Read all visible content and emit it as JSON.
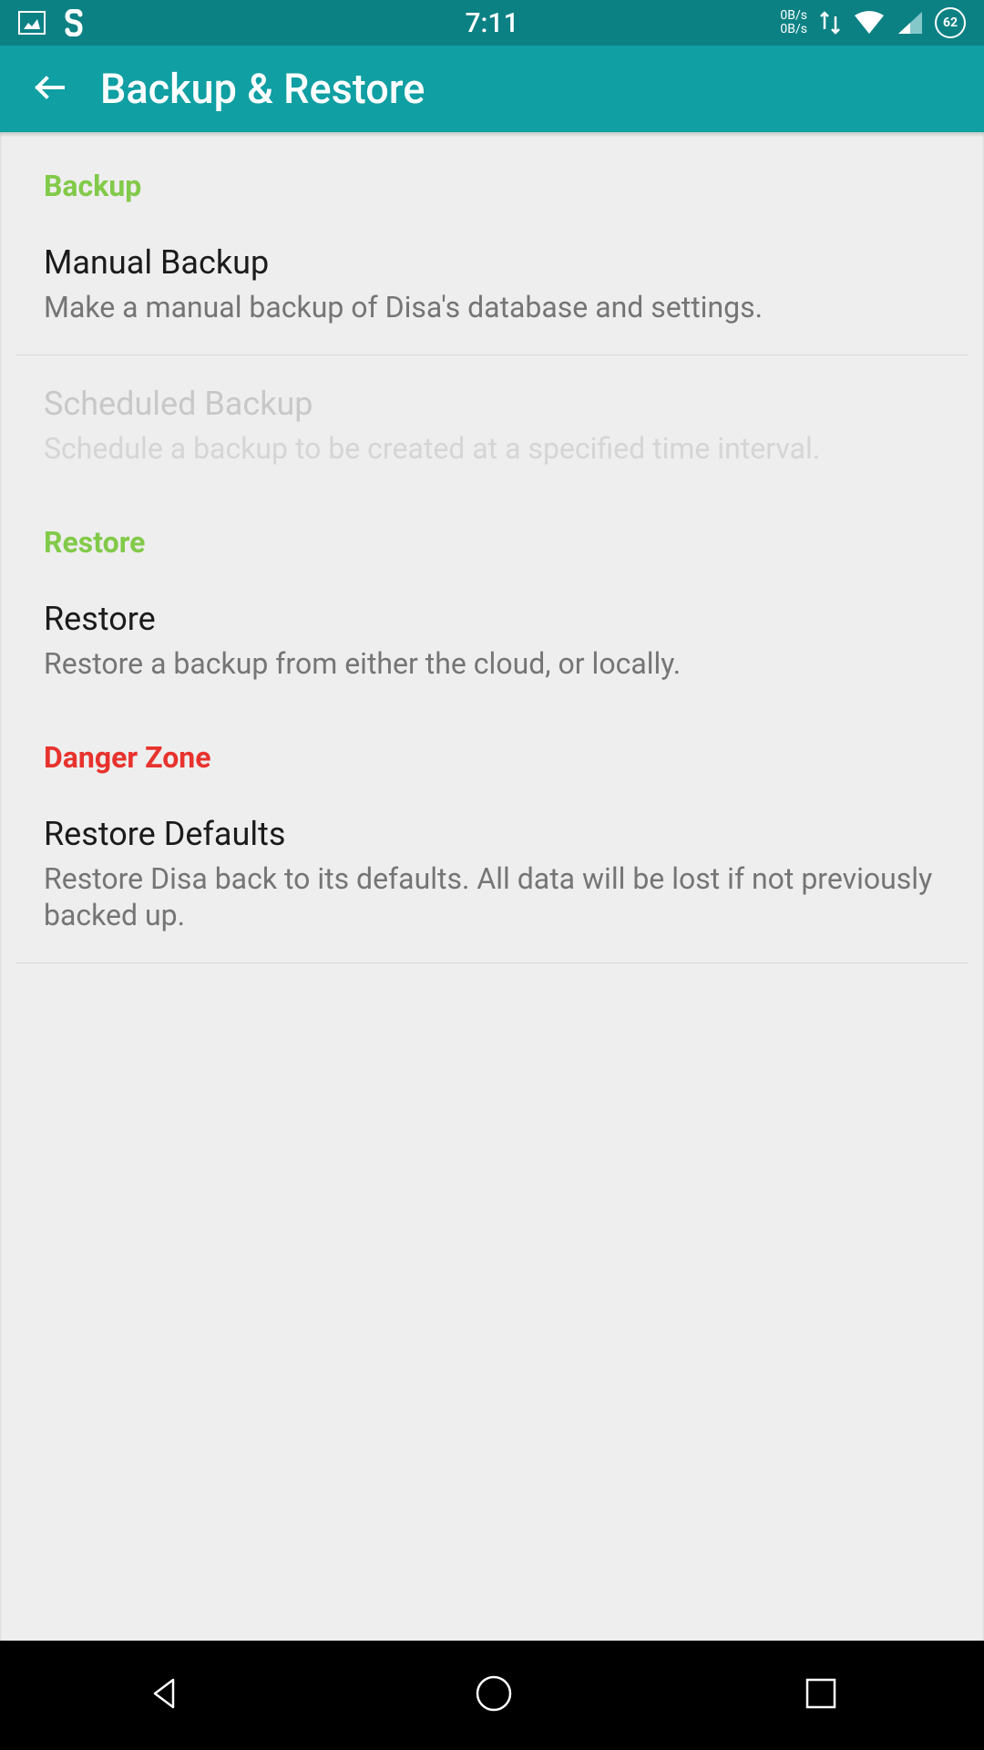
{
  "status": {
    "time": "7:11",
    "speed1": "0B/s",
    "speed2": "0B/s",
    "battery": "62"
  },
  "header": {
    "title": "Backup & Restore"
  },
  "sections": {
    "backup": {
      "label": "Backup",
      "items": [
        {
          "title": "Manual Backup",
          "desc": "Make a manual backup of Disa's database and settings."
        },
        {
          "title": "Scheduled Backup",
          "desc": "Schedule a backup to be created at a specified time interval."
        }
      ]
    },
    "restore": {
      "label": "Restore",
      "items": [
        {
          "title": "Restore",
          "desc": "Restore a backup from either the cloud, or locally."
        }
      ]
    },
    "danger": {
      "label": "Danger Zone",
      "items": [
        {
          "title": "Restore Defaults",
          "desc": "Restore Disa back to its defaults. All data will be lost if not previously backed up."
        }
      ]
    }
  }
}
